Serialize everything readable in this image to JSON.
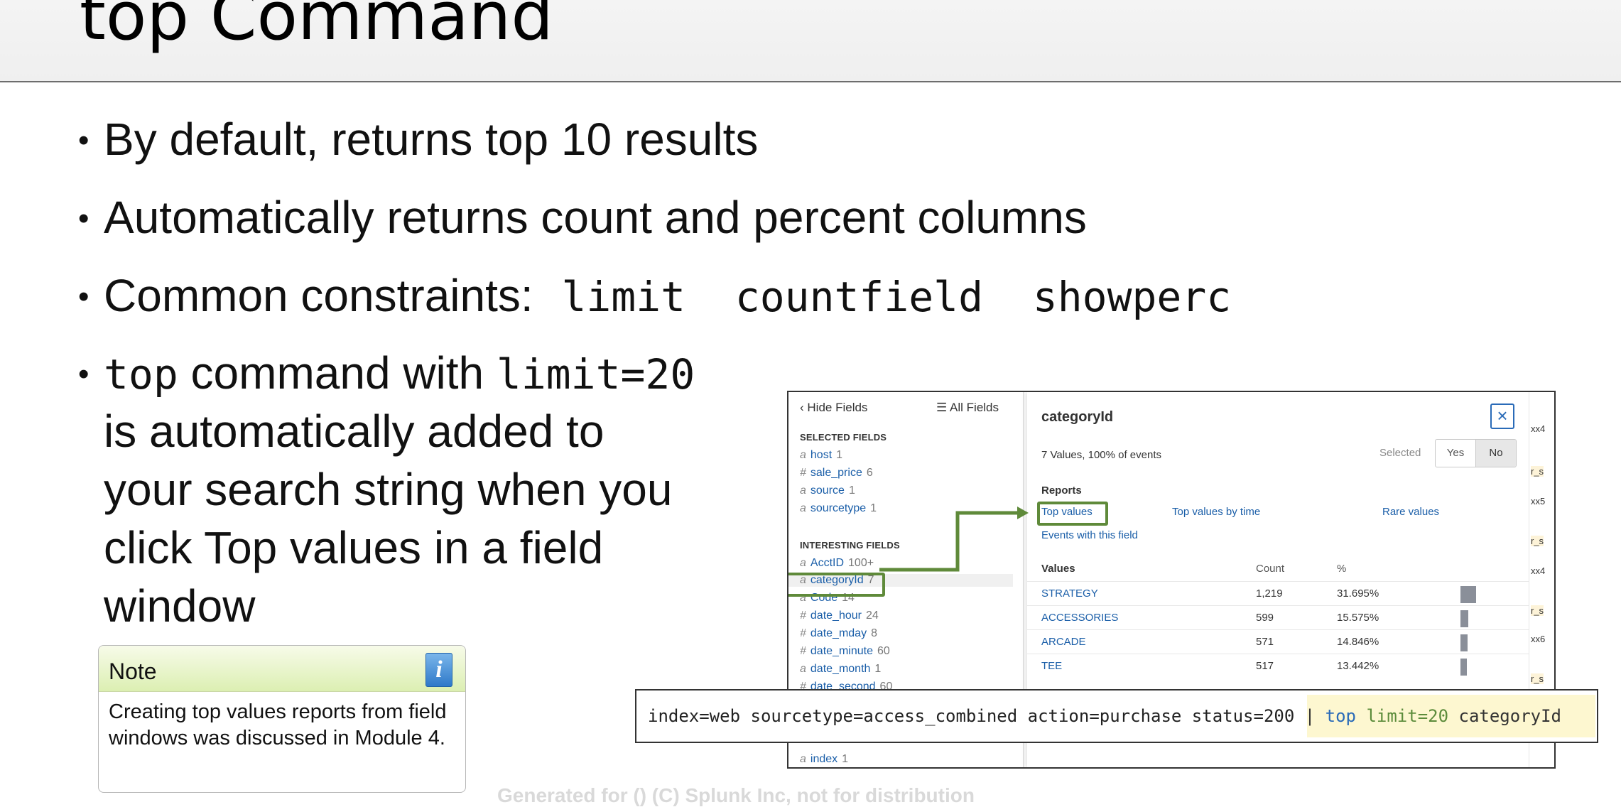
{
  "slide": {
    "title": "top Command",
    "bullets": {
      "b1": "By default, returns top 10 results",
      "b2": "Automatically returns count and percent columns",
      "b3_prefix": "Common constraints:",
      "b3_codes": [
        "limit",
        "countfield",
        "showperc"
      ],
      "b4_code1": "top",
      "b4_text1": " command with ",
      "b4_code2": "limit=20",
      "b4_lines": [
        "is automatically added to",
        "your search string when you",
        "click Top values in a field",
        "window"
      ]
    },
    "bullet_char": "•"
  },
  "note": {
    "label": "Note",
    "icon": "info-icon",
    "icon_glyph": "i",
    "body": "Creating top values reports from field windows was discussed in Module 4."
  },
  "fields_panel": {
    "hide_fields": "Hide Fields",
    "all_fields": "All Fields",
    "selected_heading": "SELECTED FIELDS",
    "selected": [
      {
        "type": "a",
        "name": "host",
        "count": "1"
      },
      {
        "type": "#",
        "name": "sale_price",
        "count": "6"
      },
      {
        "type": "a",
        "name": "source",
        "count": "1"
      },
      {
        "type": "a",
        "name": "sourcetype",
        "count": "1"
      }
    ],
    "interesting_heading": "INTERESTING FIELDS",
    "interesting": [
      {
        "type": "a",
        "name": "AcctID",
        "count": "100+"
      },
      {
        "type": "a",
        "name": "categoryId",
        "count": "7"
      },
      {
        "type": "a",
        "name": "Code",
        "count": "14"
      },
      {
        "type": "#",
        "name": "date_hour",
        "count": "24"
      },
      {
        "type": "#",
        "name": "date_mday",
        "count": "8"
      },
      {
        "type": "#",
        "name": "date_minute",
        "count": "60"
      },
      {
        "type": "a",
        "name": "date_month",
        "count": "1"
      },
      {
        "type": "#",
        "name": "date_second",
        "count": "60"
      }
    ],
    "bottom_field": {
      "type": "a",
      "name": "index",
      "count": "1"
    }
  },
  "popup": {
    "title": "categoryId",
    "close": "×",
    "summary": "7 Values, 100% of events",
    "selected_label": "Selected",
    "toggle_yes": "Yes",
    "toggle_no": "No",
    "reports_heading": "Reports",
    "links": [
      "Top values",
      "Top values by time",
      "Rare values"
    ],
    "events_link": "Events with this field",
    "col_values": "Values",
    "col_count": "Count",
    "col_pct": "%",
    "rows": [
      {
        "value": "STRATEGY",
        "count": "1,219",
        "pct": "31.695%",
        "share": 0.317
      },
      {
        "value": "ACCESSORIES",
        "count": "599",
        "pct": "15.575%",
        "share": 0.156
      },
      {
        "value": "ARCADE",
        "count": "571",
        "pct": "14.846%",
        "share": 0.148
      },
      {
        "value": "TEE",
        "count": "517",
        "pct": "13.442%",
        "share": 0.134
      }
    ]
  },
  "right_edge": [
    "xx4",
    "r_s",
    "xx5",
    "r_s",
    "xx4",
    "r_s",
    "xx6",
    "r_s"
  ],
  "command": {
    "base": "index=web sourcetype=access_combined action=purchase status=200 ",
    "pipe": "|",
    "top": " top",
    "limit": " limit=20",
    "field": " categoryId"
  },
  "watermark": "Generated for () (C) Splunk Inc, not for distribution",
  "colors": {
    "accent_green": "#5f8a3a",
    "link_blue": "#1a5ea8"
  }
}
